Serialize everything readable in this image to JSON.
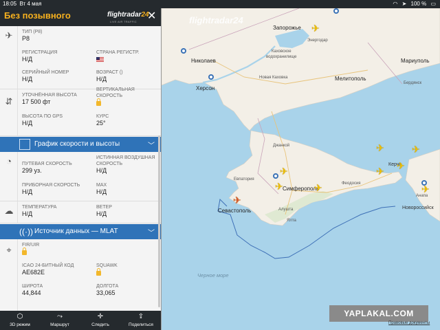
{
  "status_bar": {
    "time": "18:05",
    "date": "Вт 4 мая",
    "battery": "100 %"
  },
  "panel": {
    "title": "Без позывного",
    "logo": {
      "text": "flightradar",
      "number": "24",
      "tagline": "LIVE AIR TRAFFIC"
    },
    "aircraft": {
      "type_label": "ТИП (P8)",
      "type_value": "P8",
      "registration_label": "РЕГИСТРАЦИЯ",
      "registration_value": "Н/Д",
      "country_label": "СТРАНА РЕГИСТР.",
      "serial_label": "СЕРИЙНЫЙ НОМЕР",
      "serial_value": "Н/Д",
      "age_label": "ВОЗРАСТ ()",
      "age_value": "Н/Д"
    },
    "altitude": {
      "cal_alt_label": "УТОЧНЁННАЯ ВЫСОТА",
      "cal_alt_value": "17 500 фт",
      "vspeed_label_1": "ВЕРТИКАЛЬНАЯ",
      "vspeed_label_2": "СКОРОСТЬ",
      "gps_alt_label": "ВЫСОТА ПО GPS",
      "gps_alt_value": "Н/Д",
      "course_label": "КУРС",
      "course_value": "25°"
    },
    "speed_bar": {
      "label": "График скорости и высоты"
    },
    "speed": {
      "ground_label": "ПУТЕВАЯ СКОРОСТЬ",
      "ground_value": "299 уз.",
      "tas_label_1": "ИСТИННАЯ ВОЗДУШНАЯ",
      "tas_label_2": "СКОРОСТЬ",
      "tas_value": "Н/Д",
      "ias_label": "ПРИБОРНАЯ СКОРОСТЬ",
      "ias_value": "Н/Д",
      "max_label": "MAX",
      "max_value": "Н/Д"
    },
    "weather": {
      "temp_label": "ТЕМПЕРАТУРА",
      "temp_value": "Н/Д",
      "wind_label": "ВЕТЕР",
      "wind_value": "Н/Д"
    },
    "source_bar": {
      "label": "Источник данных — MLAT"
    },
    "source": {
      "fir_label": "FIR/UIR",
      "icao_label": "ICAO 24-БИТНЫЙ КОД",
      "icao_value": "AE682E",
      "squawk_label": "SQUAWK",
      "lat_label": "ШИРОТА",
      "lat_value": "44,844",
      "lon_label": "ДОЛГОТА",
      "lon_value": "33,065"
    }
  },
  "toolbar": {
    "btn_3d": "3D режим",
    "btn_route": "Маршрут",
    "btn_follow": "Следить",
    "btn_share": "Поделиться"
  },
  "map": {
    "watermark": "flightradar",
    "watermark_num": "24",
    "labels": {
      "zaporozhye": "Запорожье",
      "energodar": "Энергодар",
      "kakhovka_res_1": "Каховское",
      "kakhovka_res_2": "водохранилище",
      "nikolaev": "Николаев",
      "nova_kakhovka": "Новая Каховка",
      "kherson": "Херсон",
      "melitopol": "Мелитополь",
      "mariupol": "Мариуполь",
      "berdyansk": "Бердянск",
      "dzhankoy": "Джанкой",
      "kerch": "Керчь",
      "evpatoria": "Евпатория",
      "simferopol": "Симферополь",
      "feodosia": "Феодосия",
      "sevastopol": "Севастополь",
      "alushta": "Алушта",
      "yalta": "Ялта",
      "novorossiysk": "Новороссийск",
      "anapa": "Анапа",
      "black_sea": "Черное море"
    },
    "watermark_site": "YAPLAKAL.COM",
    "legal": "Правовые документы"
  }
}
